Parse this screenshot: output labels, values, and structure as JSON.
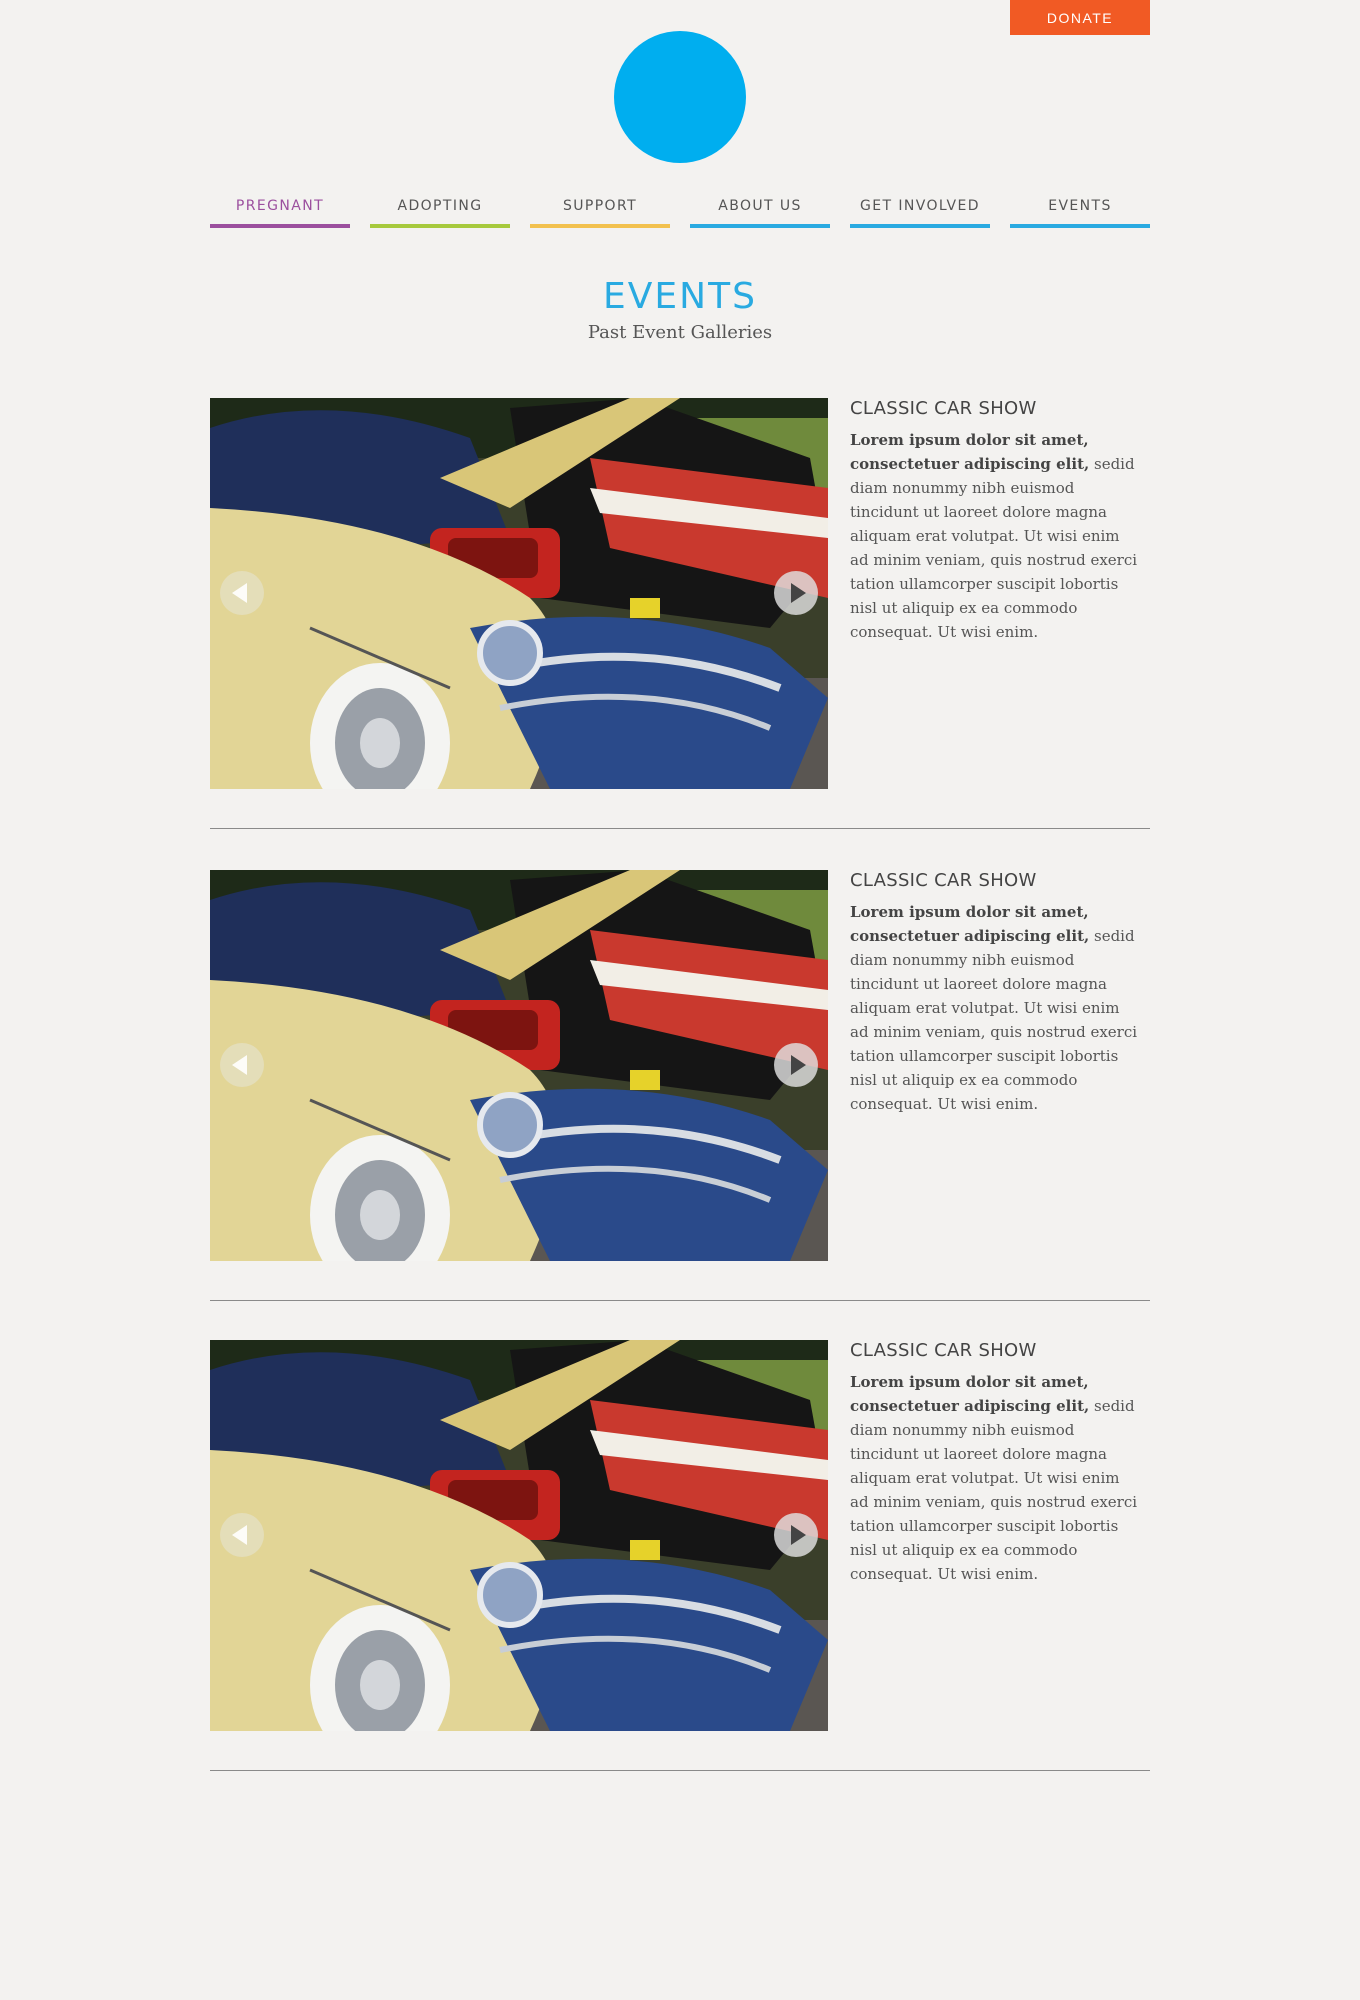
{
  "header": {
    "donate_label": "DONATE"
  },
  "colors": {
    "brand_blue": "#00aeef",
    "donate_orange": "#f15a24",
    "pregnant_purple": "#9b4f9e",
    "adopting_green": "#a6c93c",
    "support_yellow": "#f2c14e",
    "nav_blue": "#29aae1"
  },
  "nav": {
    "items": [
      {
        "label": "PREGNANT",
        "underline": "#9b4f9e",
        "active": true
      },
      {
        "label": "ADOPTING",
        "underline": "#a6c93c"
      },
      {
        "label": "SUPPORT",
        "underline": "#f2c14e"
      },
      {
        "label": "ABOUT US",
        "underline": "#29aae1"
      },
      {
        "label": "GET INVOLVED",
        "underline": "#29aae1"
      },
      {
        "label": "EVENTS",
        "underline": "#29aae1"
      }
    ]
  },
  "page": {
    "title": "EVENTS",
    "subtitle": "Past Event Galleries"
  },
  "events": [
    {
      "title": "CLASSIC CAR SHOW",
      "lead": "Lorem ipsum dolor sit amet, consectetuer adipiscing elit,",
      "body": "sedid diam nonummy nibh euismod tincidunt ut laoreet dolore magna aliquam erat volutpat. Ut wisi enim ad minim veniam, quis nostrud exerci tation ullamcorper suscipit lobortis nisl ut aliquip ex ea commodo consequat. Ut wisi enim."
    },
    {
      "title": "CLASSIC CAR SHOW",
      "lead": "Lorem ipsum dolor sit amet, consectetuer adipiscing elit,",
      "body": "sedid diam nonummy nibh euismod tincidunt ut laoreet dolore magna aliquam erat volutpat. Ut wisi enim ad minim veniam, quis nostrud exerci tation ullamcorper suscipit lobortis nisl ut aliquip ex ea commodo consequat. Ut wisi enim."
    },
    {
      "title": "CLASSIC CAR SHOW",
      "lead": "Lorem ipsum dolor sit amet, consectetuer adipiscing elit,",
      "body": "sedid diam nonummy nibh euismod tincidunt ut laoreet dolore magna aliquam erat volutpat. Ut wisi enim ad minim veniam, quis nostrud exerci tation ullamcorper suscipit lobortis nisl ut aliquip ex ea commodo consequat. Ut wisi enim."
    }
  ]
}
